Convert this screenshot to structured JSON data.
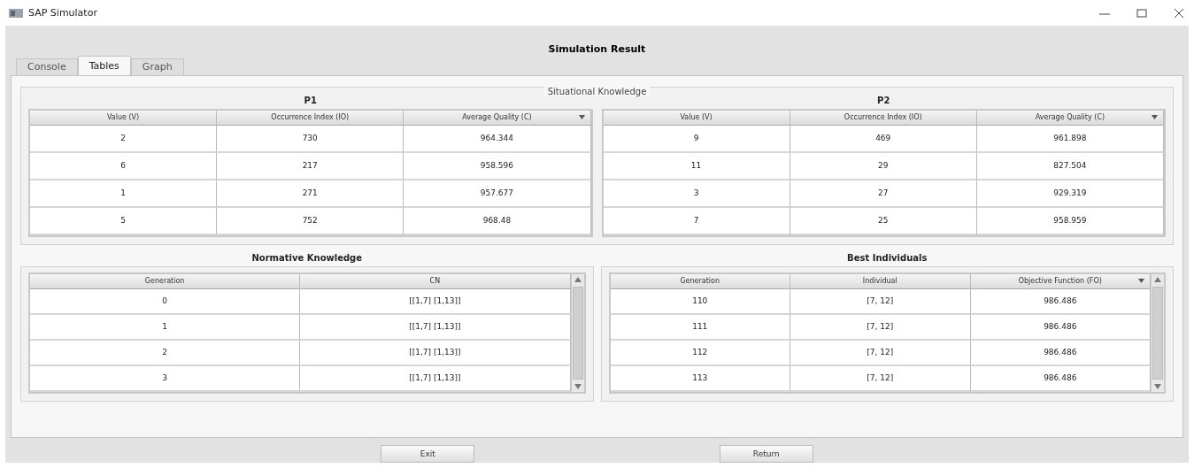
{
  "window": {
    "title": "SAP Simulator"
  },
  "heading": "Simulation Result",
  "tabs": [
    {
      "label": "Console",
      "selected": false
    },
    {
      "label": "Tables",
      "selected": true
    },
    {
      "label": "Graph",
      "selected": false
    }
  ],
  "situational_knowledge": {
    "title": "Situational Knowledge",
    "tables": [
      {
        "title": "P1",
        "columns": [
          {
            "label": "Value (V)",
            "sorted": false
          },
          {
            "label": "Occurrence Index (IO)",
            "sorted": false
          },
          {
            "label": "Average Quality (C)",
            "sorted": true
          }
        ],
        "scrollbar": false,
        "rows": [
          [
            "2",
            "730",
            "964.344"
          ],
          [
            "6",
            "217",
            "958.596"
          ],
          [
            "1",
            "271",
            "957.677"
          ],
          [
            "5",
            "752",
            "968.48"
          ]
        ]
      },
      {
        "title": "P2",
        "columns": [
          {
            "label": "Value (V)",
            "sorted": false
          },
          {
            "label": "Occurrence Index (IO)",
            "sorted": false
          },
          {
            "label": "Average Quality (C)",
            "sorted": true
          }
        ],
        "scrollbar": false,
        "rows": [
          [
            "9",
            "469",
            "961.898"
          ],
          [
            "11",
            "29",
            "827.504"
          ],
          [
            "3",
            "27",
            "929.319"
          ],
          [
            "7",
            "25",
            "958.959"
          ]
        ]
      }
    ]
  },
  "normative_knowledge": {
    "title": "Normative Knowledge",
    "columns": [
      {
        "label": "Generation",
        "sorted": false
      },
      {
        "label": "CN",
        "sorted": false
      }
    ],
    "scrollbar": true,
    "rows": [
      [
        "0",
        "[[1,7] [1,13]]"
      ],
      [
        "1",
        "[[1,7] [1,13]]"
      ],
      [
        "2",
        "[[1,7] [1,13]]"
      ],
      [
        "3",
        "[[1,7] [1,13]]"
      ]
    ]
  },
  "best_individuals": {
    "title": "Best Individuals",
    "columns": [
      {
        "label": "Generation",
        "sorted": false
      },
      {
        "label": "Individual",
        "sorted": false
      },
      {
        "label": "Objective Function (FO)",
        "sorted": true
      }
    ],
    "scrollbar": true,
    "rows": [
      [
        "110",
        "[7, 12]",
        "986.486"
      ],
      [
        "111",
        "[7, 12]",
        "986.486"
      ],
      [
        "112",
        "[7, 12]",
        "986.486"
      ],
      [
        "113",
        "[7, 12]",
        "986.486"
      ]
    ]
  },
  "buttons": [
    "Exit",
    "Return"
  ]
}
